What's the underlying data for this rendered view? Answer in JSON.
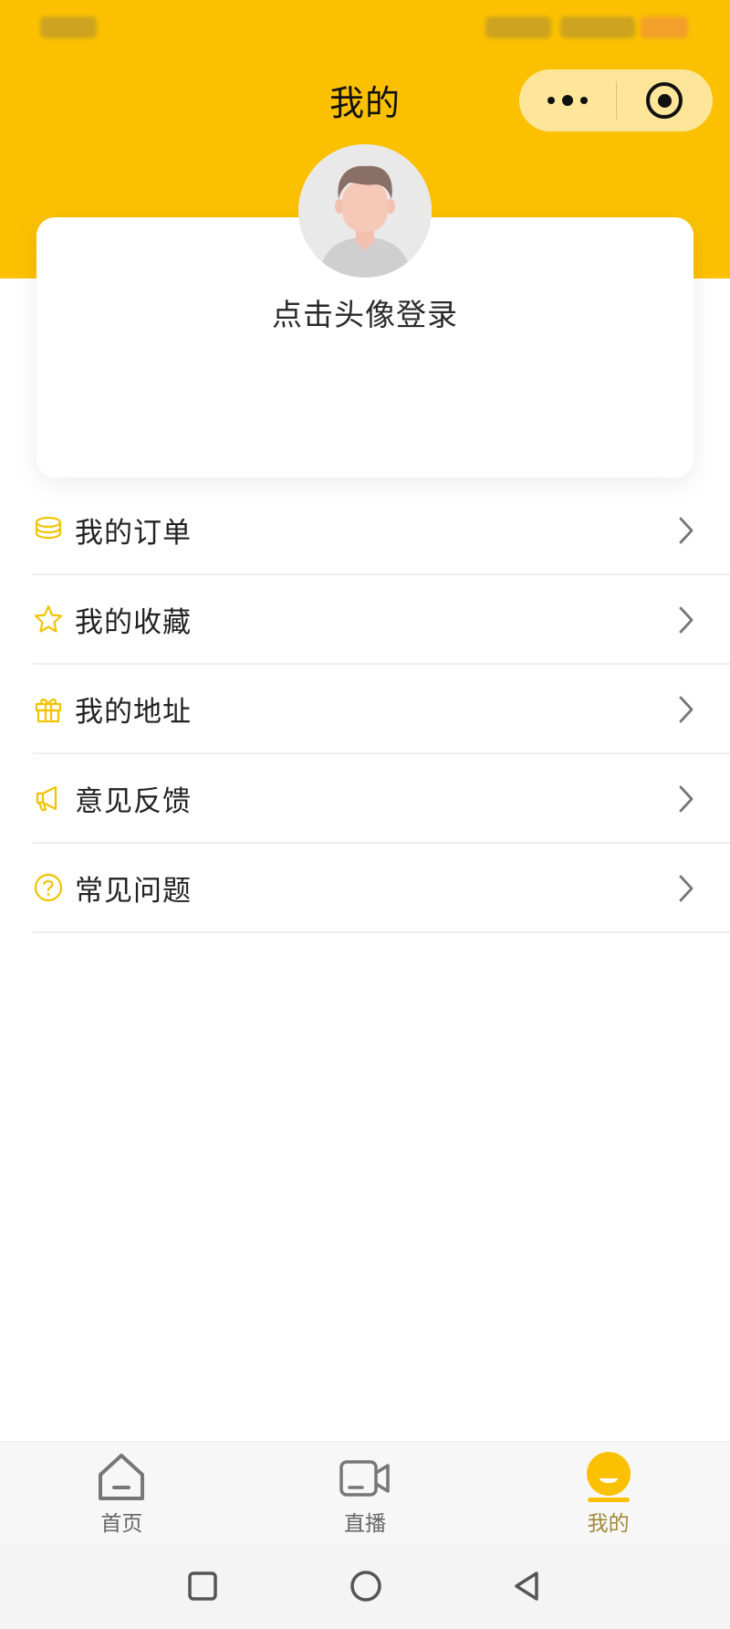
{
  "nav": {
    "title": "我的"
  },
  "profile": {
    "login_text": "点击头像登录"
  },
  "menu": [
    {
      "label": "我的订单",
      "icon": "coin-stack-icon"
    },
    {
      "label": "我的收藏",
      "icon": "star-icon"
    },
    {
      "label": "我的地址",
      "icon": "gift-icon"
    },
    {
      "label": "意见反馈",
      "icon": "megaphone-icon"
    },
    {
      "label": "常见问题",
      "icon": "question-icon"
    }
  ],
  "tabbar": {
    "items": [
      {
        "label": "首页",
        "icon": "home-icon"
      },
      {
        "label": "直播",
        "icon": "video-camera-icon"
      },
      {
        "label": "我的",
        "icon": "profile-face-icon",
        "active": true
      }
    ]
  },
  "colors": {
    "brand": "#FBC100",
    "active_tab": "#A08A3A",
    "icon_accent": "#F2C300"
  }
}
